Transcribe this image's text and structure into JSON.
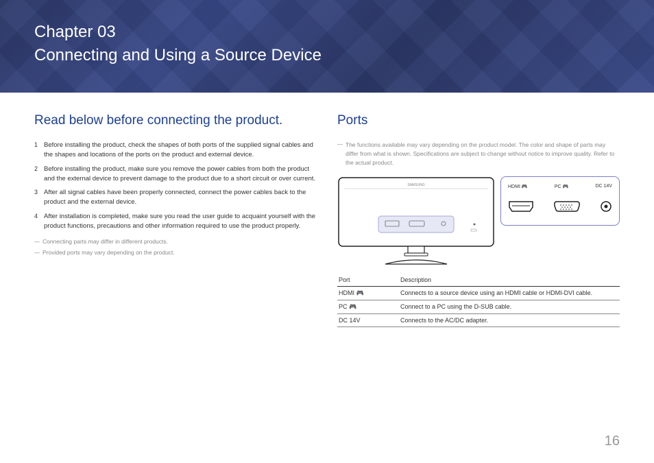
{
  "banner": {
    "chapter": "Chapter 03",
    "title": "Connecting and Using a Source Device"
  },
  "left": {
    "heading": "Read below before connecting the product.",
    "steps": [
      "Before installing the product, check the shapes of both ports of the supplied signal cables and the shapes and locations of the ports on the product and external device.",
      "Before installing the product, make sure you remove the power cables from both the product and the external device to prevent damage to the product due to a short circuit or over current.",
      "After all signal cables have been properly connected, connect the power cables back to the product and the external device.",
      "After installation is completed, make sure you read the user guide to acquaint yourself with the product functions, precautions and other information required to use the product properly."
    ],
    "footnotes": [
      "Connecting parts may differ in different products.",
      "Provided ports may vary depending on the product."
    ]
  },
  "right": {
    "heading": "Ports",
    "note": "The functions available may vary depending on the product model. The color and shape of parts may differ from what is shown. Specifications are subject to change without notice to improve quality. Refer to the actual product.",
    "monitor_brand": "SAMSUNG",
    "port_labels": {
      "hdmi": "HDMI 🎮",
      "pc": "PC 🎮",
      "dc": "DC 14V"
    },
    "table": {
      "headers": {
        "port": "Port",
        "desc": "Description"
      },
      "rows": [
        {
          "port": "HDMI 🎮",
          "desc": "Connects to a source device using an HDMI cable or HDMI-DVI cable."
        },
        {
          "port": "PC 🎮",
          "desc": "Connect to a PC using the D-SUB cable."
        },
        {
          "port": "DC 14V",
          "desc": "Connects to the AC/DC adapter."
        }
      ]
    }
  },
  "page_number": "16"
}
